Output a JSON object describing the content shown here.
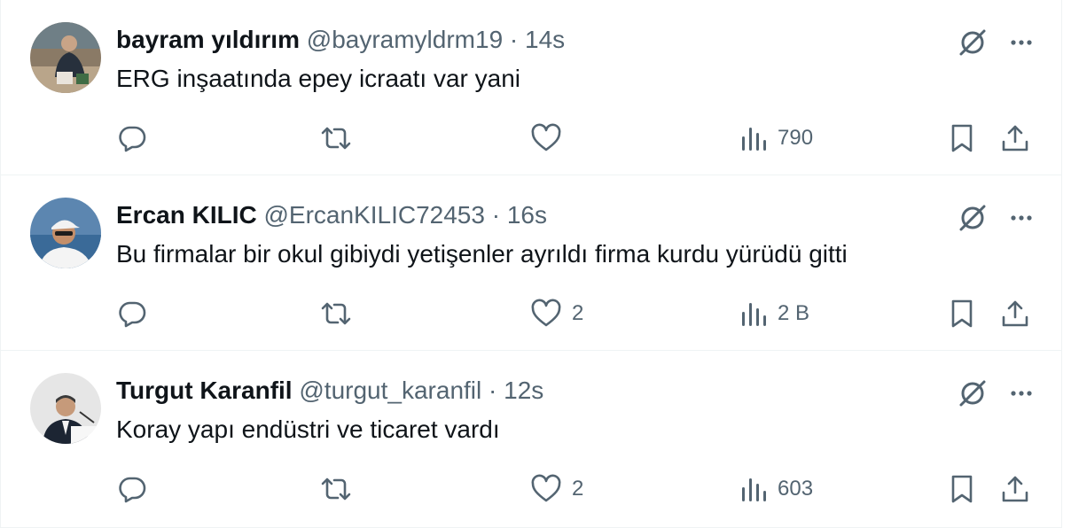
{
  "tweets": [
    {
      "name": "bayram yıldırım",
      "handle": "@bayramyldrm19",
      "dot": "·",
      "time": "14s",
      "text": "ERG inşaatında epey icraatı var yani",
      "likes": "",
      "views": "790",
      "avatar": "avatar-photo-man-seated"
    },
    {
      "name": "Ercan KILIC",
      "handle": "@ErcanKILIC72453",
      "dot": "·",
      "time": "16s",
      "text": "Bu firmalar bir okul gibiydi yetişenler ayrıldı firma kurdu yürüdü gitti",
      "likes": "2",
      "views": "2 B",
      "avatar": "avatar-photo-man-cap-sea"
    },
    {
      "name": "Turgut Karanfil",
      "handle": "@turgut_karanfil",
      "dot": "·",
      "time": "12s",
      "text": "Koray yapı endüstri ve ticaret vardı",
      "likes": "2",
      "views": "603",
      "avatar": "avatar-photo-man-podium"
    }
  ],
  "icons": {
    "grok": "grok-icon",
    "more": "more-icon",
    "reply": "reply-icon",
    "retweet": "retweet-icon",
    "like": "like-icon",
    "views": "views-icon",
    "bookmark": "bookmark-icon",
    "share": "share-icon"
  },
  "colors": {
    "text": "#0f1419",
    "secondary": "#536471",
    "divider": "#eff3f4"
  }
}
